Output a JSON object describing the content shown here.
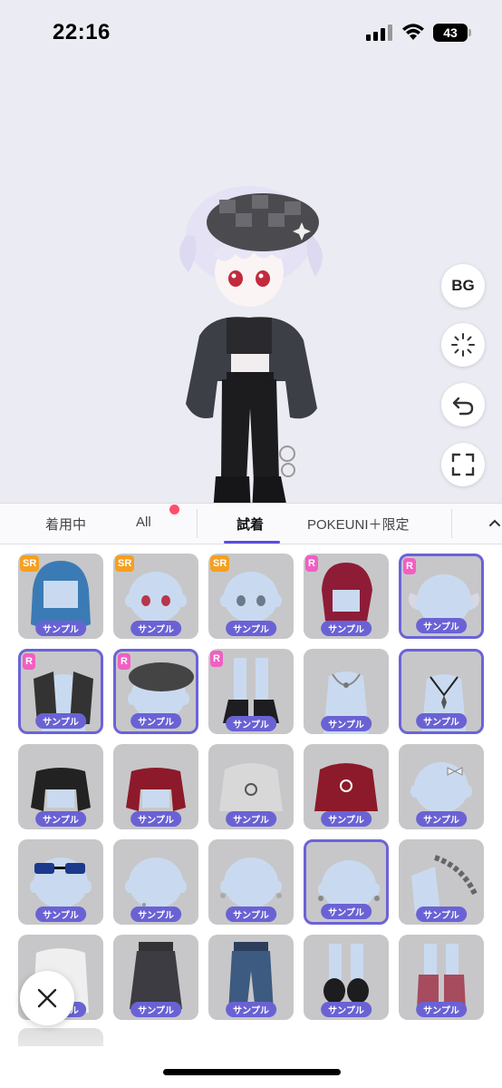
{
  "status": {
    "time": "22:16",
    "battery": "43"
  },
  "side_buttons": {
    "bg_label": "BG"
  },
  "tabs": [
    {
      "label": "着用中"
    },
    {
      "label": "All"
    },
    {
      "label": "試着"
    },
    {
      "label": "POKEUNI＋限定"
    }
  ],
  "items": [
    {
      "rarity": "SR",
      "tag": "サンプル",
      "kind": "hair-blue",
      "selected": false
    },
    {
      "rarity": "SR",
      "tag": "サンプル",
      "kind": "eyes-red",
      "selected": false
    },
    {
      "rarity": "SR",
      "tag": "サンプル",
      "kind": "eyes-grey",
      "selected": false
    },
    {
      "rarity": "R",
      "tag": "サンプル",
      "kind": "hair-red",
      "selected": false
    },
    {
      "rarity": "R",
      "tag": "サンプル",
      "kind": "hair-pigtails",
      "selected": true
    },
    {
      "rarity": "R",
      "tag": "サンプル",
      "kind": "jacket-black",
      "selected": true
    },
    {
      "rarity": "R",
      "tag": "サンプル",
      "kind": "beret",
      "selected": true
    },
    {
      "rarity": "R",
      "tag": "サンプル",
      "kind": "boots-black",
      "selected": false
    },
    {
      "rarity": "",
      "tag": "サンプル",
      "kind": "necklace-silver",
      "selected": false
    },
    {
      "rarity": "",
      "tag": "サンプル",
      "kind": "necklace-black",
      "selected": true
    },
    {
      "rarity": "",
      "tag": "サンプル",
      "kind": "crop-black",
      "selected": false
    },
    {
      "rarity": "",
      "tag": "サンプル",
      "kind": "crop-red",
      "selected": false
    },
    {
      "rarity": "",
      "tag": "サンプル",
      "kind": "hoodie-grey",
      "selected": false
    },
    {
      "rarity": "",
      "tag": "サンプル",
      "kind": "hoodie-red",
      "selected": false
    },
    {
      "rarity": "",
      "tag": "サンプル",
      "kind": "bow",
      "selected": false
    },
    {
      "rarity": "",
      "tag": "サンプル",
      "kind": "sunglasses",
      "selected": false
    },
    {
      "rarity": "",
      "tag": "サンプル",
      "kind": "earring-small",
      "selected": false
    },
    {
      "rarity": "",
      "tag": "サンプル",
      "kind": "earrings",
      "selected": false
    },
    {
      "rarity": "",
      "tag": "サンプル",
      "kind": "earrings-sel",
      "selected": true
    },
    {
      "rarity": "",
      "tag": "サンプル",
      "kind": "chain",
      "selected": false
    },
    {
      "rarity": "",
      "tag": "サンプル",
      "kind": "shirt-white",
      "selected": false
    },
    {
      "rarity": "",
      "tag": "サンプル",
      "kind": "skirt-black",
      "selected": false
    },
    {
      "rarity": "",
      "tag": "サンプル",
      "kind": "jeans",
      "selected": false
    },
    {
      "rarity": "",
      "tag": "サンプル",
      "kind": "shoes-black",
      "selected": false
    },
    {
      "rarity": "",
      "tag": "サンプル",
      "kind": "shoes-pink",
      "selected": false
    }
  ],
  "colors": {
    "accent": "#6a62d4",
    "sr": "#f5a020",
    "r": "#f15fc2",
    "dot": "#ff4f6e"
  },
  "icons": [
    "signal-icon",
    "wifi-icon",
    "battery-icon",
    "sparkle-icon",
    "undo-icon",
    "fullscreen-icon",
    "chevron-up-icon",
    "close-icon"
  ]
}
